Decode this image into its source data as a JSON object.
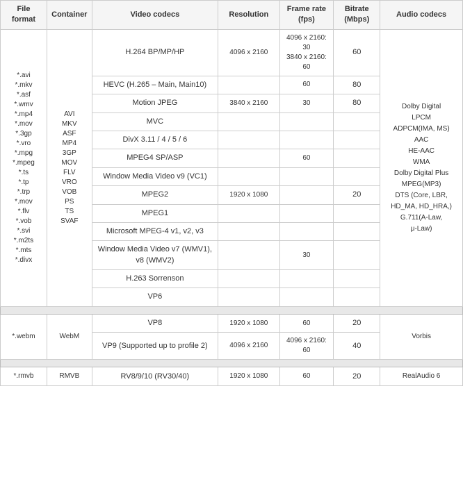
{
  "table": {
    "headers": {
      "format": "File format",
      "container": "Container",
      "video": "Video codecs",
      "resolution": "Resolution",
      "framerate": "Frame rate\n(fps)",
      "bitrate": "Bitrate\n(Mbps)",
      "audio": "Audio codecs"
    },
    "sections": [
      {
        "formats": "*.avi\n*.mkv\n*.asf\n*.wmv\n*.mp4\n*.mov\n*.3gp\n*.vro\n*.mpg\n*.mpeg\n*.ts\n*.tp\n*.trp\n*.mov\n*.flv\n*.vob\n*.svi\n*.m2ts\n*.mts\n*.divx",
        "container": "AVI\nMKV\nASF\nMP4\n3GP\nMOV\nFLV\nVRO\nVOB\nPS\nTS\nSVAF",
        "audio": "Dolby Digital\nLPCM\nADPCM(IMA, MS)\nAAC\nHE-AAC\nWMA\nDolby Digital Plus\nMPEG(MP3)\nDTS (Core, LBR,\nHD_MA, HD_HRA,)\nG.711(A-Law,\nμ-Law)",
        "rows": [
          {
            "video": "H.264 BP/MP/HP",
            "resolution": "4096 x 2160",
            "framerate": "4096 x 2160: 30\n3840 x 2160: 60",
            "bitrate": "60"
          },
          {
            "video": "HEVC (H.265 – Main, Main10)",
            "resolution": "",
            "framerate": "60",
            "bitrate": "80"
          },
          {
            "video": "Motion JPEG",
            "resolution": "3840 x 2160",
            "framerate": "30",
            "bitrate": "80"
          },
          {
            "video": "MVC",
            "resolution": "",
            "framerate": "",
            "bitrate": ""
          },
          {
            "video": "DivX 3.11 / 4 / 5 / 6",
            "resolution": "",
            "framerate": "",
            "bitrate": ""
          },
          {
            "video": "MPEG4 SP/ASP",
            "resolution": "",
            "framerate": "60",
            "bitrate": ""
          },
          {
            "video": "Window Media Video v9 (VC1)",
            "resolution": "",
            "framerate": "",
            "bitrate": ""
          },
          {
            "video": "MPEG2",
            "resolution": "1920 x 1080",
            "framerate": "",
            "bitrate": "20"
          },
          {
            "video": "MPEG1",
            "resolution": "",
            "framerate": "",
            "bitrate": ""
          },
          {
            "video": "Microsoft MPEG-4 v1, v2, v3",
            "resolution": "",
            "framerate": "",
            "bitrate": ""
          },
          {
            "video": "Window Media Video v7 (WMV1),\nv8 (WMV2)",
            "resolution": "",
            "framerate": "30",
            "bitrate": ""
          },
          {
            "video": "H.263 Sorrenson",
            "resolution": "",
            "framerate": "",
            "bitrate": ""
          },
          {
            "video": "VP6",
            "resolution": "",
            "framerate": "",
            "bitrate": ""
          }
        ]
      },
      {
        "formats": "*.webm",
        "container": "WebM",
        "audio": "Vorbis",
        "rows": [
          {
            "video": "VP8",
            "resolution": "1920 x 1080",
            "framerate": "60",
            "bitrate": "20"
          },
          {
            "video": "VP9 (Supported up to profile 2)",
            "resolution": "4096 x 2160",
            "framerate": "4096 x 2160: 60",
            "bitrate": "40"
          }
        ]
      },
      {
        "formats": "*.rmvb",
        "container": "RMVB",
        "audio": "RealAudio 6",
        "rows": [
          {
            "video": "RV8/9/10 (RV30/40)",
            "resolution": "1920 x 1080",
            "framerate": "60",
            "bitrate": "20"
          }
        ]
      }
    ]
  }
}
